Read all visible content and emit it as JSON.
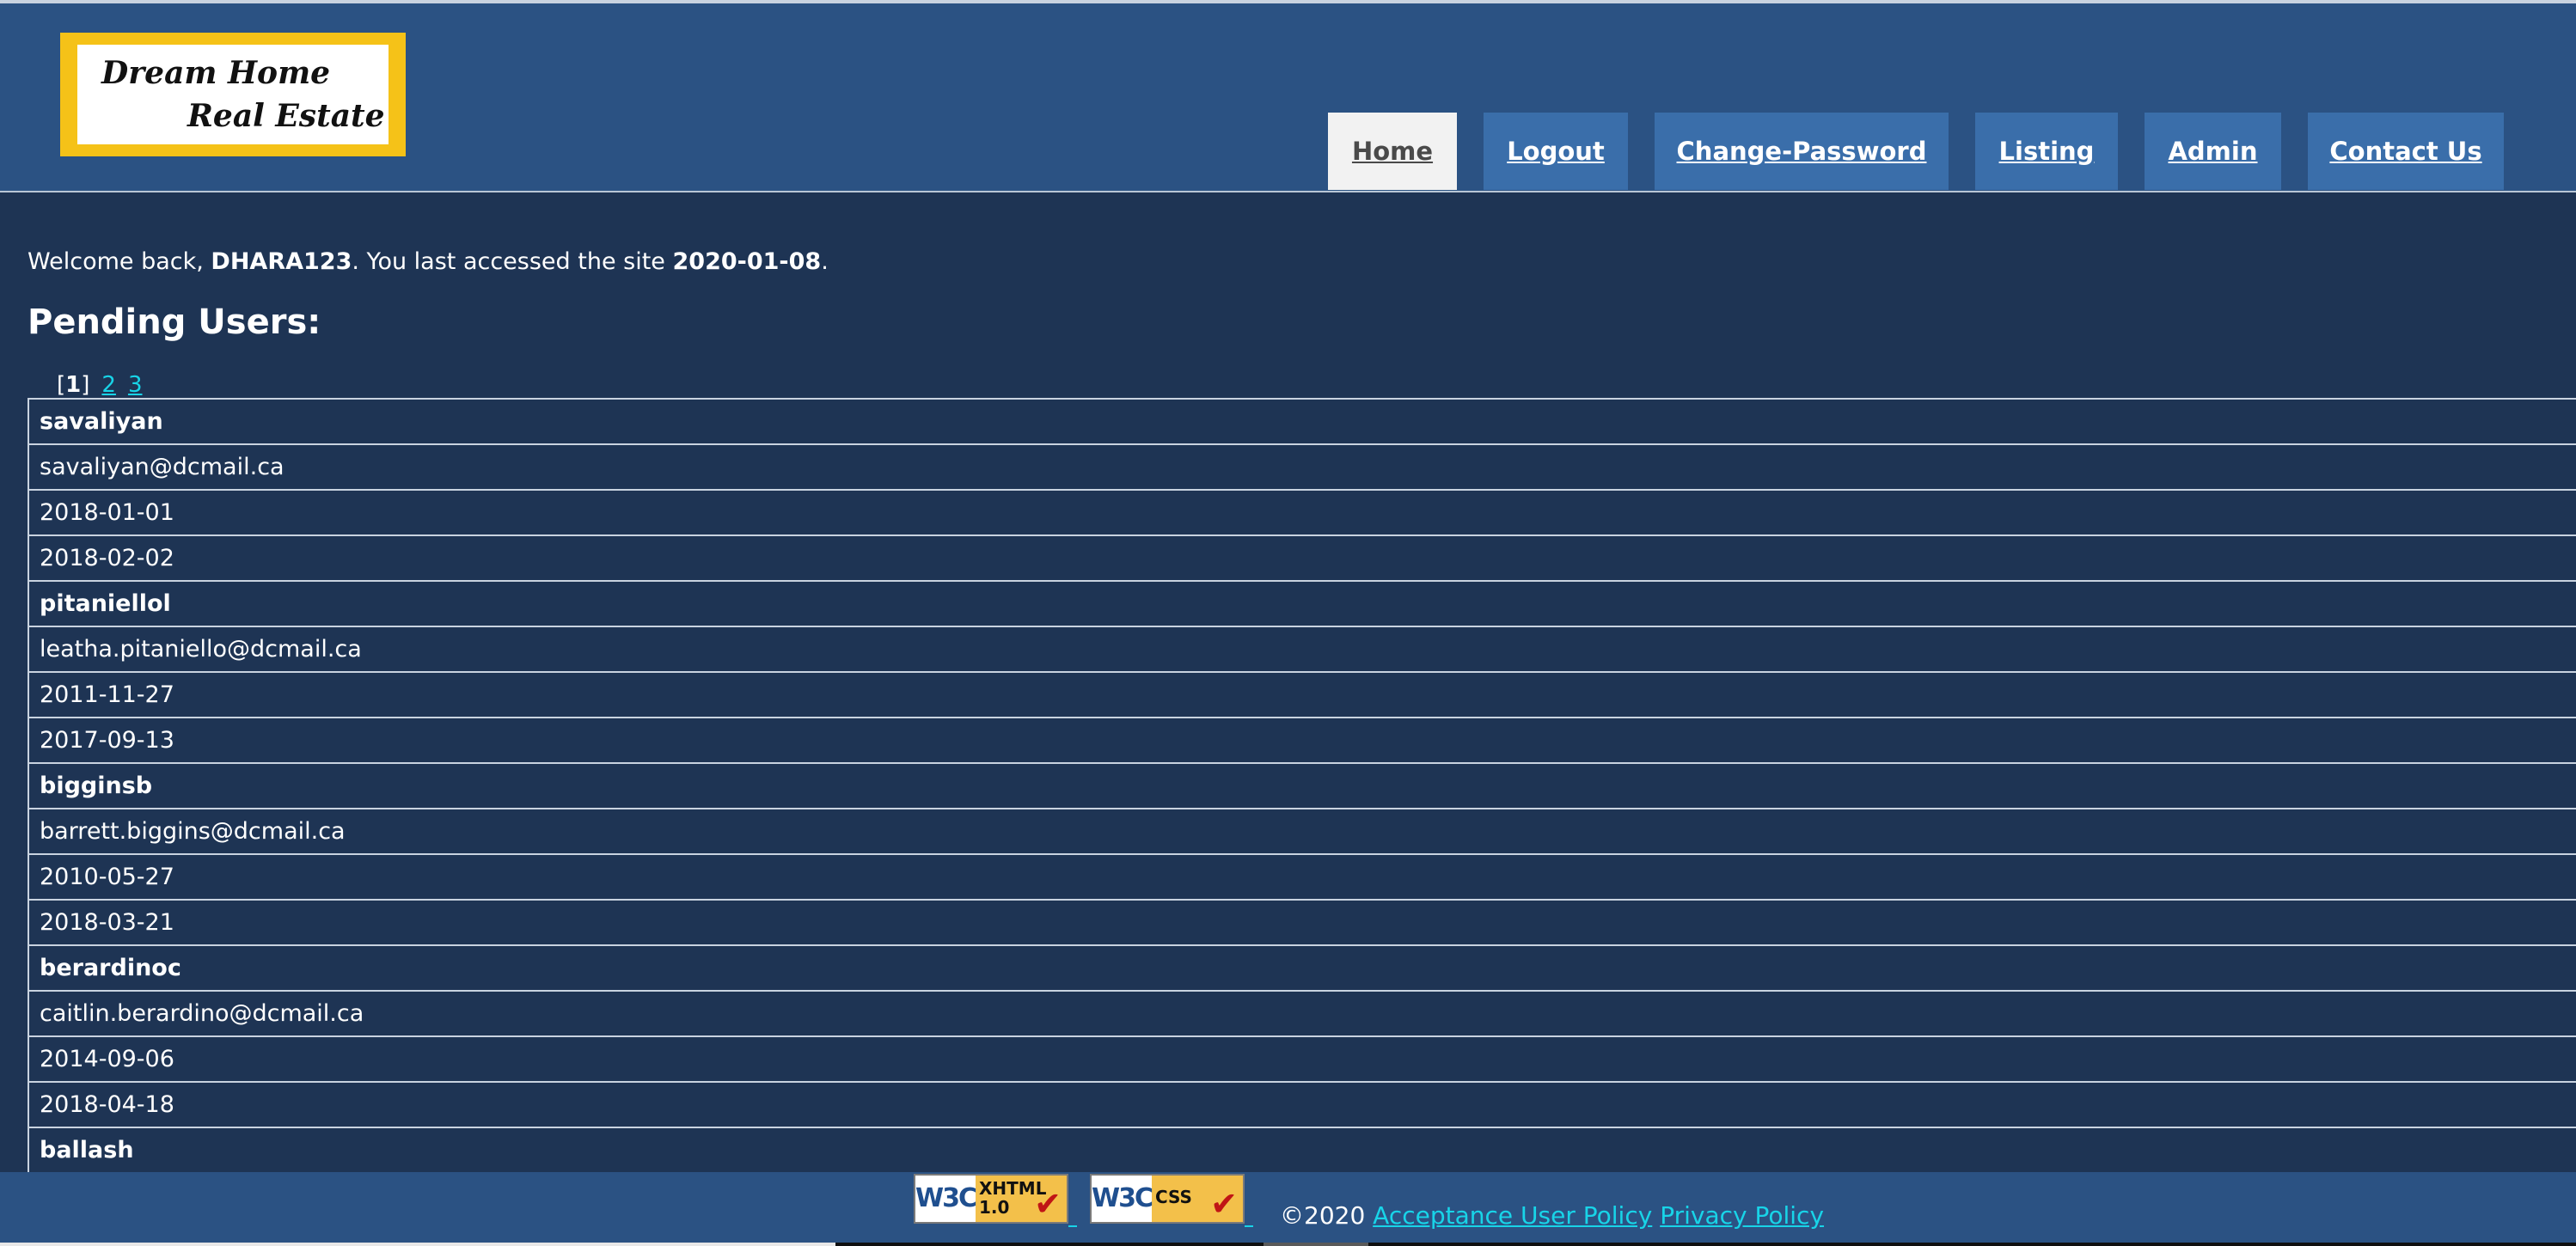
{
  "logo": {
    "line1": "Dream Home",
    "line2": "Real Estate"
  },
  "nav": {
    "items": [
      {
        "label": "Home",
        "active": true
      },
      {
        "label": "Logout"
      },
      {
        "label": "Change-Password"
      },
      {
        "label": "Listing"
      },
      {
        "label": "Admin"
      },
      {
        "label": "Contact Us"
      }
    ]
  },
  "welcome": {
    "prefix": "Welcome back, ",
    "username": "DHARA123",
    "middle": ". You last accessed the site ",
    "date": "2020-01-08",
    "suffix": "."
  },
  "section_title": "Pending Users:",
  "pager": {
    "open": "[",
    "current": "1",
    "close": "]",
    "pages": [
      "2",
      "3"
    ]
  },
  "users": [
    {
      "username": "savaliyan",
      "email": "savaliyan@dcmail.ca",
      "date1": "2018-01-01",
      "date2": "2018-02-02"
    },
    {
      "username": "pitaniellol",
      "email": "leatha.pitaniello@dcmail.ca",
      "date1": "2011-11-27",
      "date2": "2017-09-13"
    },
    {
      "username": "bigginsb",
      "email": "barrett.biggins@dcmail.ca",
      "date1": "2010-05-27",
      "date2": "2018-03-21"
    },
    {
      "username": "berardinoc",
      "email": "caitlin.berardino@dcmail.ca",
      "date1": "2014-09-06",
      "date2": "2018-04-18"
    },
    {
      "username": "ballash"
    }
  ],
  "footer": {
    "badge_xhtml": {
      "w3c": "W3C",
      "line1": "XHTML",
      "line2": "1.0"
    },
    "badge_css": {
      "w3c": "W3C",
      "line1": "CSS"
    },
    "copyright": "©2020 ",
    "link1": "Acceptance User Policy",
    "link2": "Privacy Policy"
  },
  "colors": {
    "background": "#1e3454",
    "header": "#2b5283",
    "nav_button": "#3a6eaa",
    "link": "#18d4e8",
    "logo_frame": "#f5c218"
  }
}
